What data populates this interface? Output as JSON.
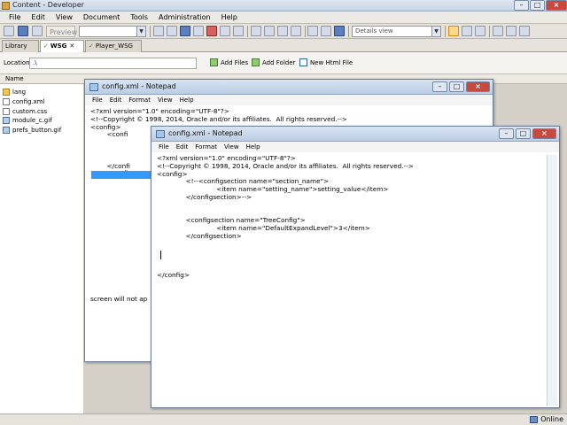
{
  "app": {
    "title": "Content - Developer"
  },
  "menubar": [
    "File",
    "Edit",
    "View",
    "Document",
    "Tools",
    "Administration",
    "Help"
  ],
  "toolbar": {
    "preview_label": "Preview",
    "view_combo": "Details view"
  },
  "tabs": [
    {
      "label": "Library",
      "active": false
    },
    {
      "label": "WSG",
      "active": true
    },
    {
      "label": "Player_WSG",
      "active": false
    }
  ],
  "location": {
    "label": "Location:",
    "value": ".\\"
  },
  "actions": {
    "add_files": "Add Files",
    "add_folder": "Add Folder",
    "new_html": "New Html File"
  },
  "file_list": {
    "column_name": "Name",
    "items": [
      "lang",
      "config.xml",
      "custom.css",
      "module_c.gif",
      "prefs_button.gif"
    ]
  },
  "notepad_back": {
    "title": "config.xml - Notepad",
    "menu": [
      "File",
      "Edit",
      "Format",
      "View",
      "Help"
    ],
    "lines": [
      "<?xml version=\"1.0\" encoding=\"UTF-8\"?>",
      "<!--Copyright © 1998, 2014, Oracle and/or its affiliates.  All rights reserved.-->",
      "<config>",
      "        <confi",
      "",
      "",
      "",
      "        </confi",
      "        <confi"
    ],
    "bottom_text": "screen will not ap"
  },
  "notepad_front": {
    "title": "config.xml - Notepad",
    "menu": [
      "File",
      "Edit",
      "Format",
      "View",
      "Help"
    ],
    "lines": [
      "<?xml version=\"1.0\" encoding=\"UTF-8\"?>",
      "<!--Copyright © 1998, 2014, Oracle and/or its affiliates.  All rights reserved.-->",
      "<config>",
      "              <!--<configsection name=\"section_name\">",
      "                             <item name=\"setting_name\">setting_value</item>",
      "              </configsection>-->",
      "",
      "",
      "              <configsection name=\"TreeConfig\">",
      "                             <item name=\"DefaultExpandLevel\">3</item>",
      "              </configsection>",
      "",
      "",
      "",
      "",
      "</config>"
    ]
  },
  "status": {
    "text": "Online"
  }
}
